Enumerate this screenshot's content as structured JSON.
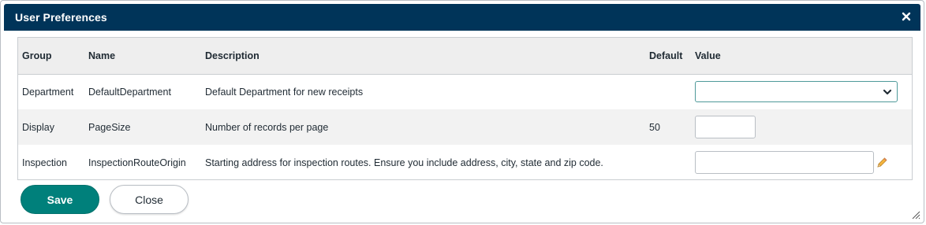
{
  "dialog": {
    "title": "User Preferences",
    "close_icon": "close-icon"
  },
  "table": {
    "headers": [
      "Group",
      "Name",
      "Description",
      "Default",
      "Value"
    ],
    "rows": [
      {
        "group": "Department",
        "name": "DefaultDepartment",
        "description": "Default Department for new receipts",
        "default": "",
        "value": ""
      },
      {
        "group": "Display",
        "name": "PageSize",
        "description": "Number of records per page",
        "default": "50",
        "value": ""
      },
      {
        "group": "Inspection",
        "name": "InspectionRouteOrigin",
        "description": "Starting address for inspection routes. Ensure you include address, city, state and zip code.",
        "default": "",
        "value": ""
      }
    ]
  },
  "buttons": {
    "save": "Save",
    "close": "Close"
  },
  "colors": {
    "titlebar": "#003459",
    "primary": "#00807b"
  }
}
